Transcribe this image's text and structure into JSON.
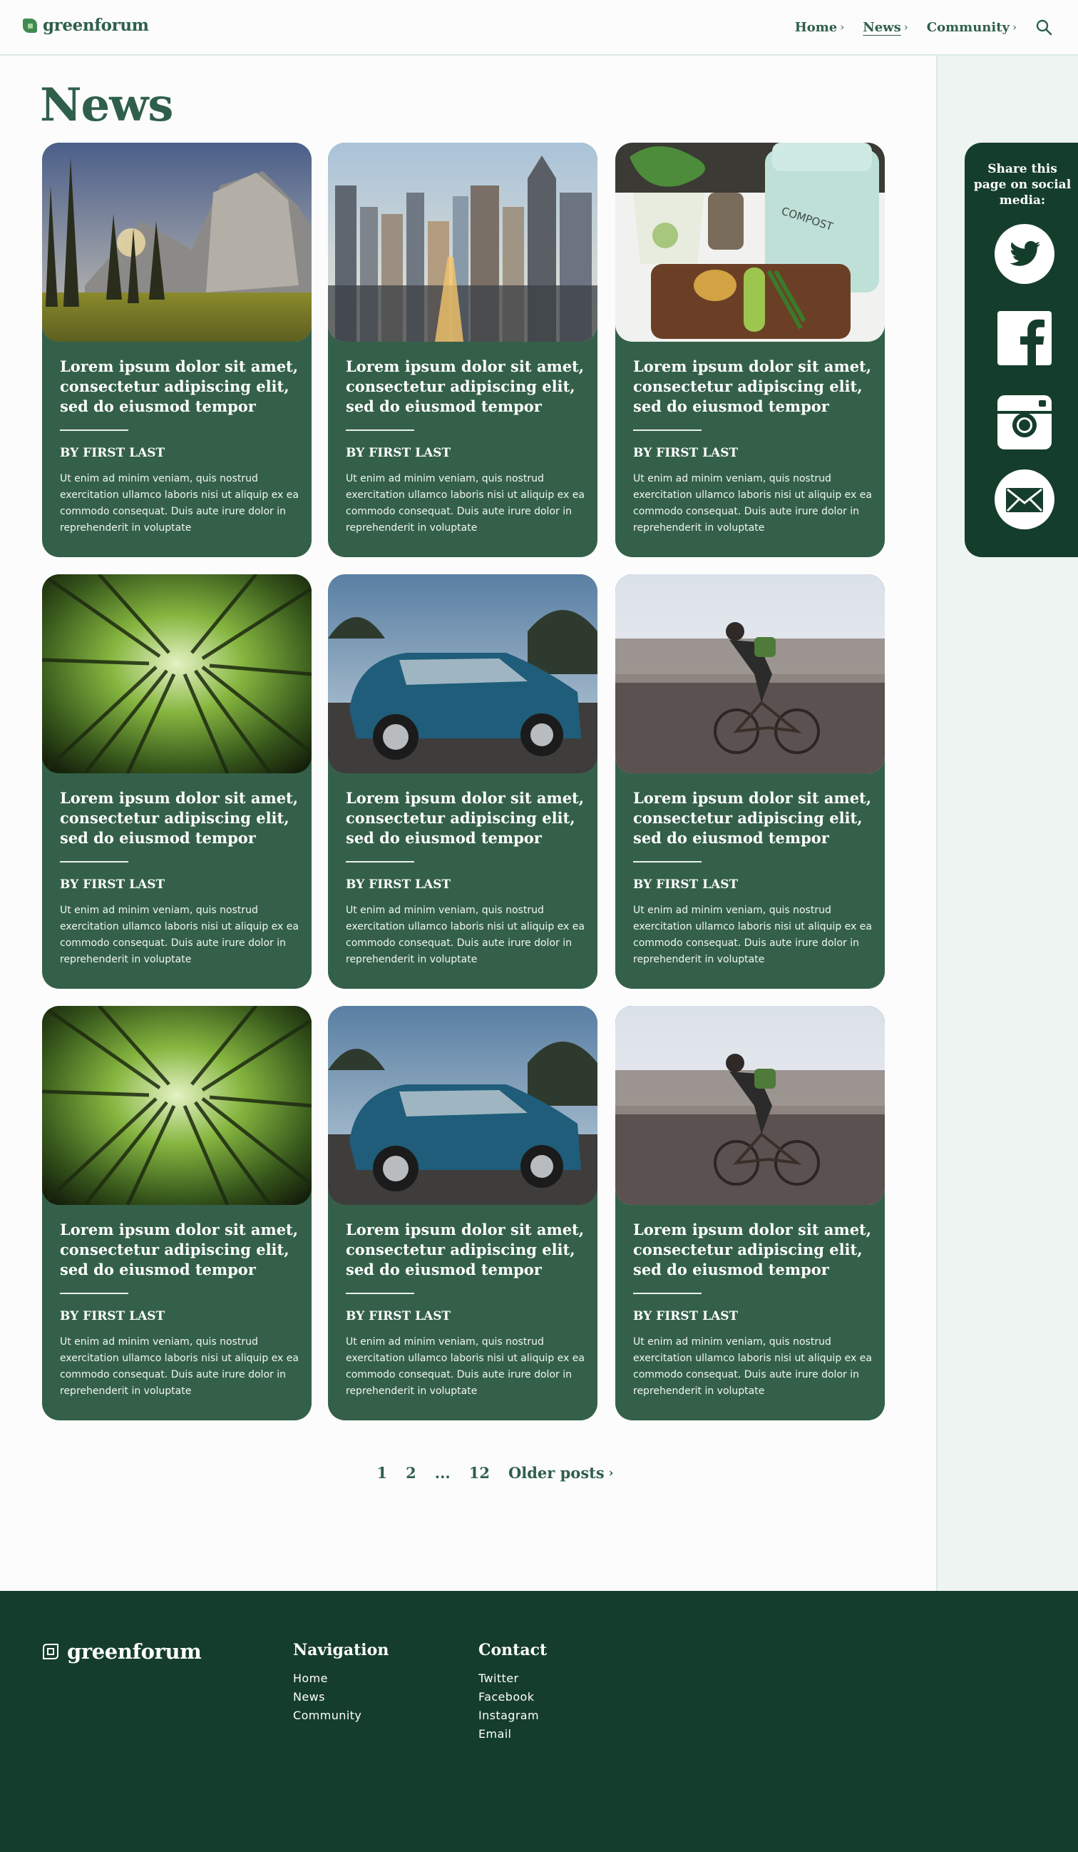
{
  "header": {
    "logo_text": "greenforum",
    "nav": [
      {
        "label": "Home",
        "chevron": "›"
      },
      {
        "label": "News",
        "chevron": "›"
      },
      {
        "label": "Community",
        "chevron": "›"
      }
    ],
    "search_icon": "search-icon"
  },
  "page_title": "News",
  "share": {
    "title": "Share this page on social media:",
    "icons": [
      "twitter-icon",
      "facebook-icon",
      "instagram-icon",
      "email-icon"
    ]
  },
  "cards": [
    {
      "image": "mountain-valley-photo",
      "title": "Lorem ipsum dolor sit amet, consectetur adipiscing elit, sed do eiusmod tempor",
      "author": "BY FIRST LAST",
      "body": "Ut enim ad minim veniam, quis nostrud exercitation ullamco laboris nisi ut aliquip ex ea commodo consequat. Duis aute irure dolor in reprehenderit in voluptate"
    },
    {
      "image": "city-skyline-photo",
      "title": "Lorem ipsum dolor sit amet, consectetur adipiscing elit, sed do eiusmod tempor",
      "author": "BY FIRST LAST",
      "body": "Ut enim ad minim veniam, quis nostrud exercitation ullamco laboris nisi ut aliquip ex ea commodo consequat. Duis aute irure dolor in reprehenderit in voluptate"
    },
    {
      "image": "compost-kitchen-photo",
      "title": "Lorem ipsum dolor sit amet, consectetur adipiscing elit, sed do eiusmod tempor",
      "author": "BY FIRST LAST",
      "body": "Ut enim ad minim veniam, quis nostrud exercitation ullamco laboris nisi ut aliquip ex ea commodo consequat. Duis aute irure dolor in reprehenderit in voluptate",
      "image_text": "COMPOST"
    },
    {
      "image": "bamboo-forest-photo",
      "title": "Lorem ipsum dolor sit amet, consectetur adipiscing elit, sed do eiusmod tempor",
      "author": "BY FIRST LAST",
      "body": "Ut enim ad minim veniam, quis nostrud exercitation ullamco laboris nisi ut aliquip ex ea commodo consequat. Duis aute irure dolor in reprehenderit in voluptate"
    },
    {
      "image": "blue-car-photo",
      "title": "Lorem ipsum dolor sit amet, consectetur adipiscing elit, sed do eiusmod tempor",
      "author": "BY FIRST LAST",
      "body": "Ut enim ad minim veniam, quis nostrud exercitation ullamco laboris nisi ut aliquip ex ea commodo consequat. Duis aute irure dolor in reprehenderit in voluptate"
    },
    {
      "image": "cyclist-photo",
      "title": "Lorem ipsum dolor sit amet, consectetur adipiscing elit, sed do eiusmod tempor",
      "author": "BY FIRST LAST",
      "body": "Ut enim ad minim veniam, quis nostrud exercitation ullamco laboris nisi ut aliquip ex ea commodo consequat. Duis aute irure dolor in reprehenderit in voluptate"
    },
    {
      "image": "bamboo-forest-photo",
      "title": "Lorem ipsum dolor sit amet, consectetur adipiscing elit, sed do eiusmod tempor",
      "author": "BY FIRST LAST",
      "body": "Ut enim ad minim veniam, quis nostrud exercitation ullamco laboris nisi ut aliquip ex ea commodo consequat. Duis aute irure dolor in reprehenderit in voluptate"
    },
    {
      "image": "blue-car-photo",
      "title": "Lorem ipsum dolor sit amet, consectetur adipiscing elit, sed do eiusmod tempor",
      "author": "BY FIRST LAST",
      "body": "Ut enim ad minim veniam, quis nostrud exercitation ullamco laboris nisi ut aliquip ex ea commodo consequat. Duis aute irure dolor in reprehenderit in voluptate"
    },
    {
      "image": "cyclist-photo",
      "title": "Lorem ipsum dolor sit amet, consectetur adipiscing elit, sed do eiusmod tempor",
      "author": "BY FIRST LAST",
      "body": "Ut enim ad minim veniam, quis nostrud exercitation ullamco laboris nisi ut aliquip ex ea commodo consequat. Duis aute irure dolor in reprehenderit in voluptate"
    }
  ],
  "pagination": {
    "pages": [
      "1",
      "2",
      "...",
      "12"
    ],
    "older_label": "Older posts",
    "older_chevron": "›"
  },
  "footer": {
    "logo_text": "greenforum",
    "navigation": {
      "heading": "Navigation",
      "links": [
        "Home",
        "News",
        "Community"
      ]
    },
    "contact": {
      "heading": "Contact",
      "links": [
        "Twitter",
        "Facebook",
        "Instagram",
        "Email"
      ]
    }
  },
  "colors": {
    "primary": "#2f5f4b",
    "card": "#346049",
    "dark": "#153d2c",
    "rail": "#eef4f1",
    "background": "#fcfcfc"
  }
}
